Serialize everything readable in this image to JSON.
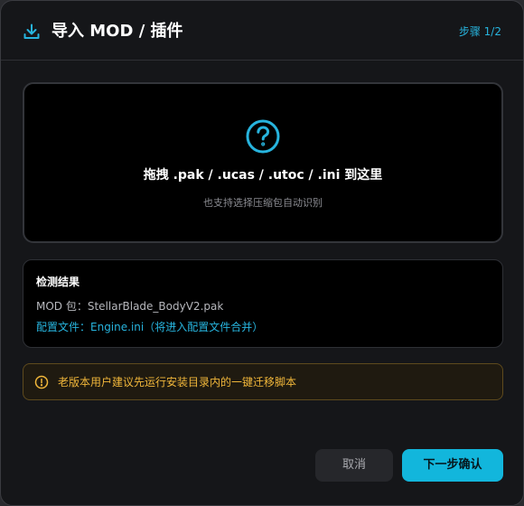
{
  "dialog": {
    "title": "导入 MOD / 插件",
    "step": "步骤 1/2",
    "accent_color": "#27b4de"
  },
  "dropzone": {
    "icon": "help-circle-icon",
    "title": "拖拽 .pak / .ucas / .utoc / .ini 到这里",
    "subtitle": "也支持选择压缩包自动识别"
  },
  "result": {
    "title": "检测结果",
    "mod_line": "MOD 包：StellarBlade_BodyV2.pak",
    "config_line": "配置文件：Engine.ini（将进入配置文件合并）"
  },
  "warning": {
    "icon": "info-circle-icon",
    "text": "老版本用户建议先运行安装目录内的一键迁移脚本",
    "color": "#f0b63a"
  },
  "footer": {
    "cancel_label": "取消",
    "next_label": "下一步确认"
  }
}
